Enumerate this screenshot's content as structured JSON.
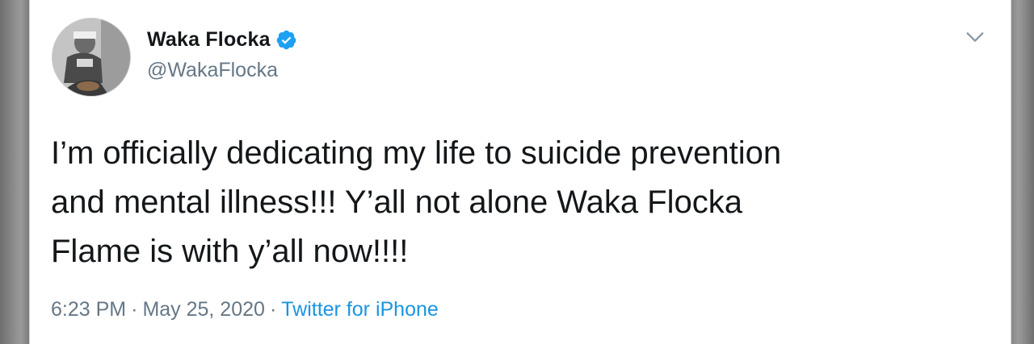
{
  "tweet": {
    "author": {
      "display_name": "Waka Flocka",
      "handle": "@WakaFlocka",
      "verified": true,
      "avatar_icon": "profile-photo"
    },
    "menu_icon": "chevron-down-icon",
    "text_lines": [
      "I’m officially dedicating my life to suicide prevention",
      "and mental illness!!! Y’all not alone Waka Flocka",
      "Flame is with y’all now!!!!"
    ],
    "time": "6:23 PM",
    "separator": "·",
    "date": "May 25, 2020",
    "source": "Twitter for iPhone"
  },
  "colors": {
    "text": "#14171a",
    "muted": "#657786",
    "link": "#1b95e0",
    "verified": "#1da1f2"
  }
}
